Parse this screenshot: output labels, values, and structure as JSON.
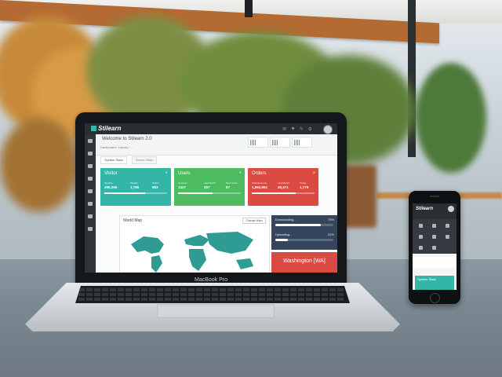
{
  "laptop": {
    "brand": "MacBook Pro",
    "app": {
      "logo": "Stilearn",
      "welcome": "Welcome to Stilearn 2.0",
      "breadcrumb": "Dashboard  /  Library  /  ...",
      "tabs": [
        "System Stats",
        "Server Stats"
      ],
      "cards": [
        {
          "title": "Visitor",
          "color": "#33b6a8",
          "stats": [
            {
              "label": "Monthly",
              "value": "295,296"
            },
            {
              "label": "Weekly",
              "value": "1,785"
            },
            {
              "label": "Online",
              "value": "963"
            }
          ],
          "progress": 0.65
        },
        {
          "title": "Users",
          "color": "#4dbb60",
          "stats": [
            {
              "label": "All Users",
              "value": "1437"
            },
            {
              "label": "Last Month",
              "value": "287"
            },
            {
              "label": "New Users",
              "value": "67"
            }
          ],
          "progress": 0.55
        },
        {
          "title": "Orders",
          "color": "#db4b43",
          "stats": [
            {
              "label": "Total Revenue",
              "value": "1,994,951"
            },
            {
              "label": "Last Month",
              "value": "49,471"
            },
            {
              "label": "Today",
              "value": "1,779"
            }
          ],
          "progress": 0.7
        }
      ],
      "map": {
        "title": "World Map",
        "button": "Change Maps"
      },
      "downloads": [
        {
          "label": "Downloading...",
          "percent": "79%",
          "fraction": 0.79
        },
        {
          "label": "Uploading...",
          "percent": "22%",
          "fraction": 0.22
        }
      ],
      "weather": "Washington [WA]"
    }
  },
  "phone": {
    "logo": "Stilearn",
    "tab": "System Stats"
  },
  "colors": {
    "teal": "#33b6a8",
    "green": "#4dbb60",
    "red": "#db4b43",
    "navy": "#35465c",
    "dark": "#2a2e33"
  }
}
